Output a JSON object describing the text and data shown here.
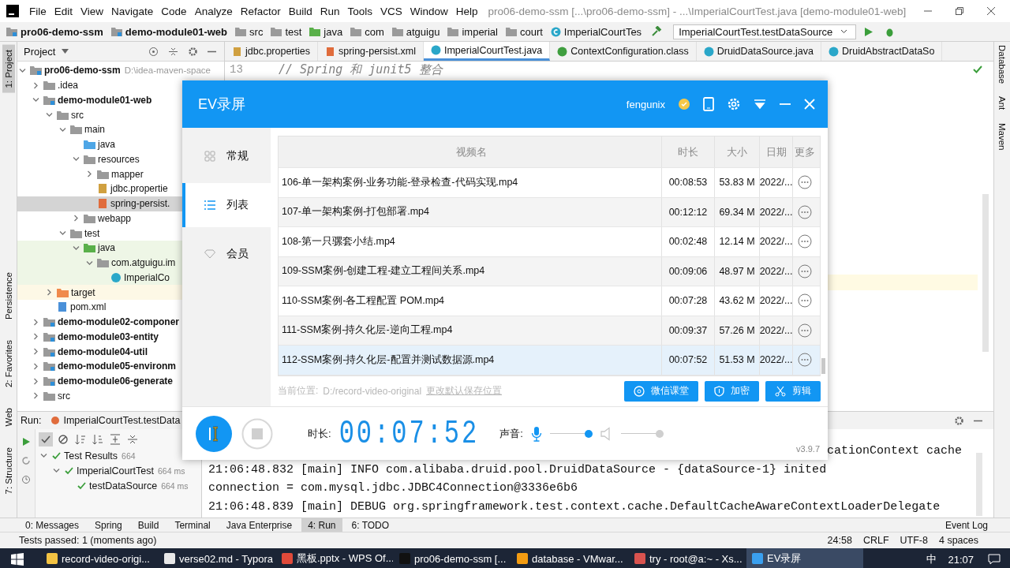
{
  "menu_bar": {
    "items": [
      "File",
      "Edit",
      "View",
      "Navigate",
      "Code",
      "Analyze",
      "Refactor",
      "Build",
      "Run",
      "Tools",
      "VCS",
      "Window",
      "Help"
    ],
    "title": "pro06-demo-ssm [...\\pro06-demo-ssm] - ...\\ImperialCourtTest.java [demo-module01-web]"
  },
  "nav_bar": {
    "crumbs": [
      {
        "label": "pro06-demo-ssm",
        "kind": "module"
      },
      {
        "label": "demo-module01-web",
        "kind": "module"
      },
      {
        "label": "src",
        "kind": "folder"
      },
      {
        "label": "test",
        "kind": "folder"
      },
      {
        "label": "java",
        "kind": "test-root"
      },
      {
        "label": "com",
        "kind": "package"
      },
      {
        "label": "atguigu",
        "kind": "package"
      },
      {
        "label": "imperial",
        "kind": "package"
      },
      {
        "label": "court",
        "kind": "package"
      },
      {
        "label": "ImperialCourtTes",
        "kind": "class"
      }
    ],
    "run_config": "ImperialCourtTest.testDataSource"
  },
  "left_strip": [
    {
      "label": "1: Project",
      "selected": true
    },
    {
      "label": "Persistence",
      "selected": false
    },
    {
      "label": "2: Favorites",
      "selected": false
    },
    {
      "label": "Web",
      "selected": false
    },
    {
      "label": "7: Structure",
      "selected": false
    }
  ],
  "right_strip": [
    "Database",
    "Ant",
    "Maven"
  ],
  "project_panel": {
    "title": "Project",
    "tree": [
      {
        "label": "pro06-demo-ssm",
        "hint": "D:\\idea-maven-space",
        "kind": "module",
        "expanded": true,
        "selected": false,
        "children": [
          {
            "label": ".idea",
            "kind": "folder",
            "expanded": false,
            "selected": false
          },
          {
            "label": "demo-module01-web",
            "kind": "module",
            "expanded": true,
            "selected": false,
            "children": [
              {
                "label": "src",
                "kind": "folder",
                "expanded": true,
                "selected": false,
                "children": [
                  {
                    "label": "main",
                    "kind": "folder",
                    "expanded": true,
                    "selected": false,
                    "children": [
                      {
                        "label": "java",
                        "kind": "src-root",
                        "selected": false
                      },
                      {
                        "label": "resources",
                        "kind": "res-root",
                        "expanded": true,
                        "selected": false,
                        "children": [
                          {
                            "label": "mapper",
                            "kind": "folder",
                            "expanded": false,
                            "selected": false
                          },
                          {
                            "label": "jdbc.propertie",
                            "kind": "props",
                            "selected": false
                          },
                          {
                            "label": "spring-persist.",
                            "kind": "xml",
                            "selected": true
                          }
                        ]
                      },
                      {
                        "label": "webapp",
                        "kind": "web",
                        "expanded": false,
                        "selected": false
                      }
                    ]
                  },
                  {
                    "label": "test",
                    "kind": "folder",
                    "expanded": true,
                    "selected": false,
                    "children": [
                      {
                        "label": "java",
                        "kind": "test-root",
                        "expanded": true,
                        "selected": false,
                        "children": [
                          {
                            "label": "com.atguigu.im",
                            "kind": "package",
                            "expanded": true,
                            "selected": false,
                            "children": [
                              {
                                "label": "ImperialCo",
                                "kind": "class",
                                "selected": false
                              }
                            ]
                          }
                        ]
                      }
                    ]
                  }
                ]
              },
              {
                "label": "target",
                "kind": "excluded",
                "expanded": false,
                "selected": false
              },
              {
                "label": "pom.xml",
                "kind": "pom",
                "selected": false
              }
            ]
          },
          {
            "label": "demo-module02-componer",
            "kind": "module",
            "expanded": false,
            "selected": false
          },
          {
            "label": "demo-module03-entity",
            "kind": "module",
            "expanded": false,
            "selected": false
          },
          {
            "label": "demo-module04-util",
            "kind": "module",
            "expanded": false,
            "selected": false
          },
          {
            "label": "demo-module05-environm",
            "kind": "module",
            "expanded": false,
            "selected": false
          },
          {
            "label": "demo-module06-generate",
            "kind": "module",
            "expanded": false,
            "selected": false
          },
          {
            "label": "src",
            "kind": "folder",
            "expanded": false,
            "selected": false
          }
        ]
      }
    ]
  },
  "editor": {
    "tabs": [
      {
        "label": "jdbc.properties",
        "kind": "props",
        "selected": false
      },
      {
        "label": "spring-persist.xml",
        "kind": "xml",
        "selected": false
      },
      {
        "label": "ImperialCourtTest.java",
        "kind": "java",
        "selected": true
      },
      {
        "label": "ContextConfiguration.class",
        "kind": "classfile",
        "selected": false
      },
      {
        "label": "DruidDataSource.java",
        "kind": "java",
        "selected": false
      },
      {
        "label": "DruidAbstractDataSo",
        "kind": "java",
        "selected": false
      }
    ],
    "line_number": "13",
    "code": "// Spring 和 junit5 整合"
  },
  "run_panel": {
    "label": "Run:",
    "tab": "ImperialCourtTest.testData",
    "tests": [
      {
        "label": "Test Results",
        "time": "664",
        "expanded": true,
        "selected": false,
        "children": [
          {
            "label": "ImperialCourtTest",
            "time": "664 ms",
            "expanded": true,
            "selected": false,
            "children": [
              {
                "label": "testDataSource",
                "time": "664 ms",
                "selected": false
              }
            ]
          }
        ]
      }
    ],
    "console": [
      {
        "kind": "tail",
        "text": "cationContext cache"
      },
      {
        "kind": "line",
        "text": "21:06:48.832 [main] INFO com.alibaba.druid.pool.DruidDataSource - {dataSource-1} inited"
      },
      {
        "kind": "line",
        "text": "connection = com.mysql.jdbc.JDBC4Connection@3336e6b6"
      },
      {
        "kind": "line",
        "text": "21:06:48.839 [main] DEBUG org.springframework.test.context.cache.DefaultCacheAwareContextLoaderDelegate"
      }
    ]
  },
  "tool_tabs": [
    {
      "label": "0: Messages",
      "selected": false
    },
    {
      "label": "Spring",
      "selected": false
    },
    {
      "label": "Build",
      "selected": false
    },
    {
      "label": "Terminal",
      "selected": false
    },
    {
      "label": "Java Enterprise",
      "selected": false
    },
    {
      "label": "4: Run",
      "selected": true
    },
    {
      "label": "6: TODO",
      "selected": false
    }
  ],
  "event_log": "Event Log",
  "status_bar": {
    "message": "Tests passed: 1 (moments ago)",
    "items": [
      "24:58",
      "CRLF",
      "UTF-8",
      "4 spaces"
    ]
  },
  "taskbar": {
    "items": [
      {
        "label": "record-video-origi...",
        "kind": "folder",
        "selected": false
      },
      {
        "label": "verse02.md - Typora",
        "kind": "typora",
        "selected": false
      },
      {
        "label": "黑板.pptx - WPS Of...",
        "kind": "wps",
        "selected": false
      },
      {
        "label": "pro06-demo-ssm [...",
        "kind": "idea",
        "selected": false
      },
      {
        "label": "database - VMwar...",
        "kind": "vmware",
        "selected": false
      },
      {
        "label": "try - root@a:~ - Xs...",
        "kind": "xshell",
        "selected": false
      },
      {
        "label": "EV录屏",
        "kind": "ev",
        "selected": true
      }
    ],
    "ime": "中",
    "time": "21:07"
  },
  "recorder": {
    "title": "EV录屏",
    "user": "fengunix",
    "nav": [
      {
        "label": "常规",
        "kind": "grid",
        "selected": false
      },
      {
        "label": "列表",
        "kind": "list",
        "selected": true
      },
      {
        "label": "会员",
        "kind": "gem",
        "selected": false
      }
    ],
    "columns": [
      "视频名",
      "时长",
      "大小",
      "日期",
      "更多"
    ],
    "rows": [
      {
        "name": "106-单一架构案例-业务功能-登录检查-代码实现.mp4",
        "duration": "00:08:53",
        "size": "53.83 M",
        "date": "2022/...",
        "selected": false
      },
      {
        "name": "107-单一架构案例-打包部署.mp4",
        "duration": "00:12:12",
        "size": "69.34 M",
        "date": "2022/...",
        "selected": false
      },
      {
        "name": "108-第一只骡套小结.mp4",
        "duration": "00:02:48",
        "size": "12.14 M",
        "date": "2022/...",
        "selected": false
      },
      {
        "name": "109-SSM案例-创建工程-建立工程间关系.mp4",
        "duration": "00:09:06",
        "size": "48.97 M",
        "date": "2022/...",
        "selected": false
      },
      {
        "name": "110-SSM案例-各工程配置 POM.mp4",
        "duration": "00:07:28",
        "size": "43.62 M",
        "date": "2022/...",
        "selected": false
      },
      {
        "name": "111-SSM案例-持久化层-逆向工程.mp4",
        "duration": "00:09:37",
        "size": "57.26 M",
        "date": "2022/...",
        "selected": false
      },
      {
        "name": "112-SSM案例-持久化层-配置并测试数据源.mp4",
        "duration": "00:07:52",
        "size": "51.53 M",
        "date": "2022/...",
        "selected": true
      }
    ],
    "location_label": "当前位置:",
    "location": "D:/record-video-original",
    "change_link": "更改默认保存位置",
    "buttons": [
      {
        "label": "微信课堂",
        "kind": "wechat"
      },
      {
        "label": "加密",
        "kind": "shield"
      },
      {
        "label": "剪辑",
        "kind": "scissors"
      }
    ],
    "duration_label": "时长:",
    "timer": "00:07:52",
    "sound_label": "声音:",
    "mic": {
      "on": true,
      "level": 1
    },
    "speaker": {
      "on": false,
      "level": 1
    },
    "version": "v3.9.7"
  }
}
